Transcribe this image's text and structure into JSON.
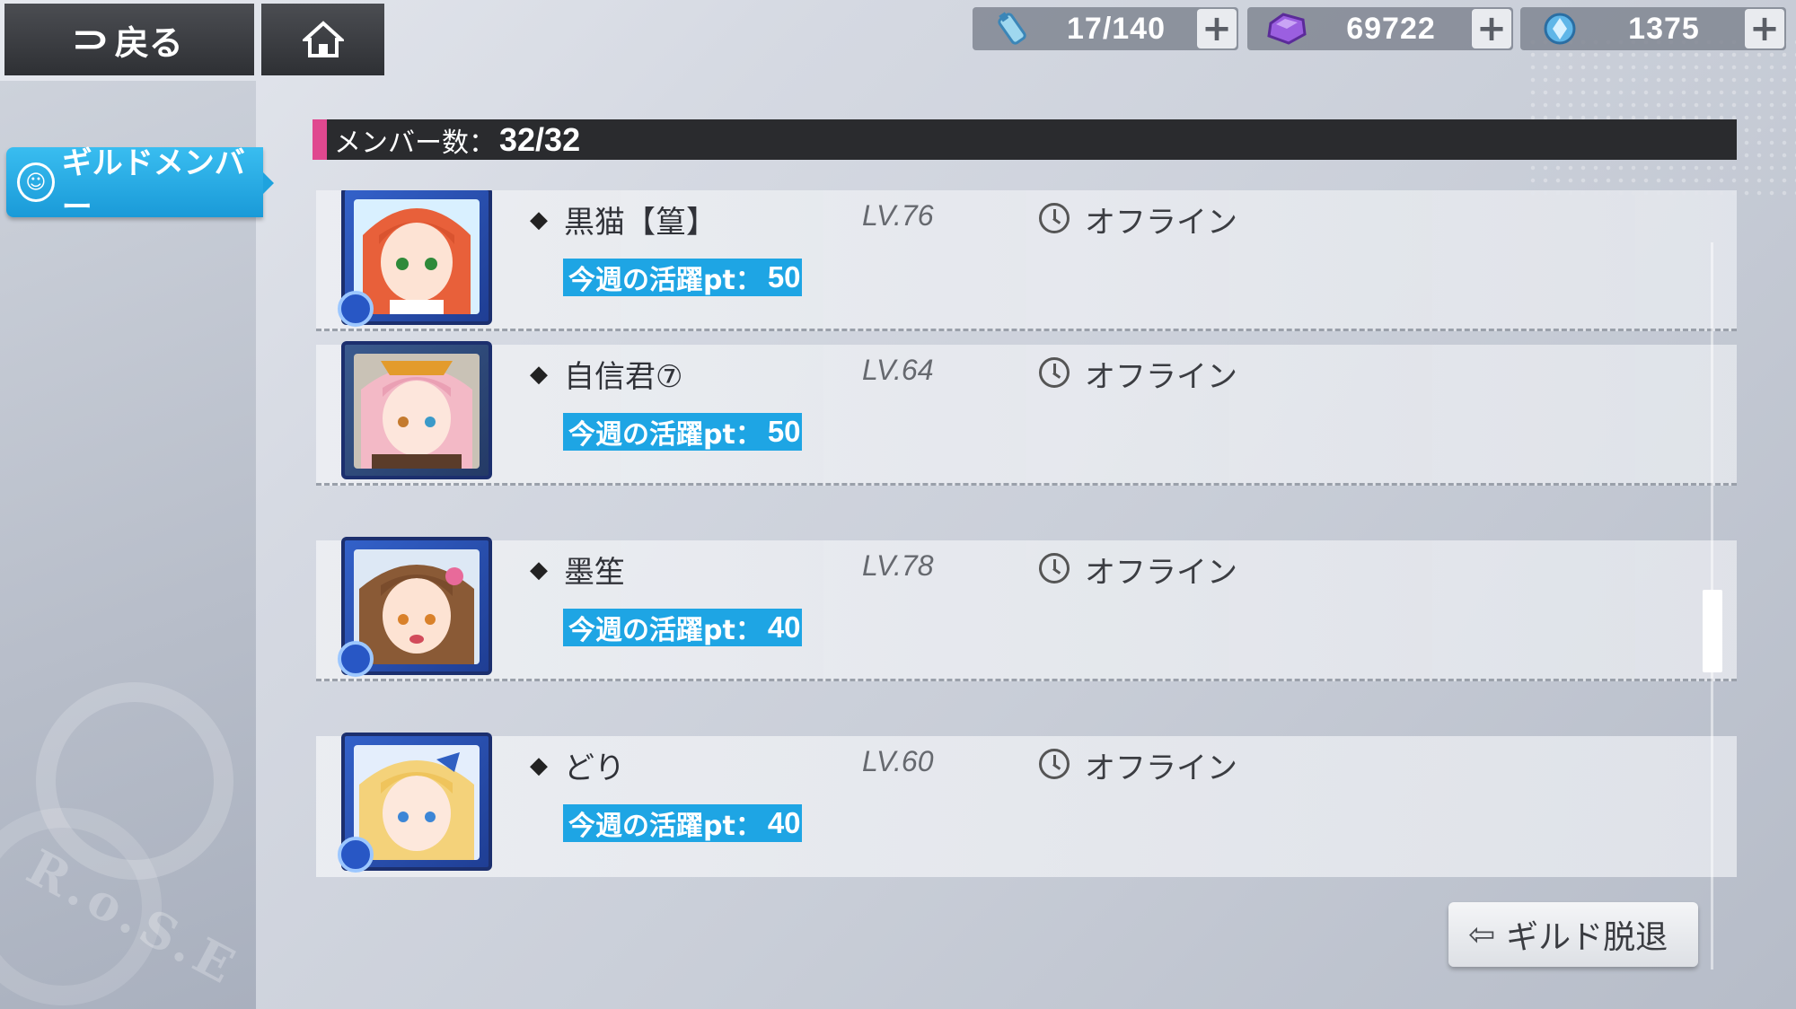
{
  "topbar": {
    "back_label": "戻る",
    "resources": [
      {
        "icon": "stamina-bottle-icon",
        "value": "17/140",
        "plus": "+"
      },
      {
        "icon": "purple-gem-icon",
        "value": "69722",
        "plus": "+"
      },
      {
        "icon": "blue-crystal-icon",
        "value": "1375",
        "plus": "+"
      }
    ]
  },
  "sidebar": {
    "tab_label": "ギルドメンバー"
  },
  "header": {
    "label": "メンバー数：",
    "count": "32/32"
  },
  "members": [
    {
      "name": "黒猫【篁】",
      "level": "LV.76",
      "status": "オフライン",
      "points_label": "今週の活躍pt：",
      "points": "50"
    },
    {
      "name": "自信君⑦",
      "level": "LV.64",
      "status": "オフライン",
      "points_label": "今週の活躍pt：",
      "points": "50"
    },
    {
      "name": "墨笙",
      "level": "LV.78",
      "status": "オフライン",
      "points_label": "今週の活躍pt：",
      "points": "40"
    },
    {
      "name": "どり",
      "level": "LV.60",
      "status": "オフライン",
      "points_label": "今週の活躍pt：",
      "points": "40"
    }
  ],
  "footer": {
    "leave_label": "ギルド脱退"
  },
  "background": {
    "watermark": "R.o.S.E"
  },
  "colors": {
    "accent_blue": "#1ea5e4",
    "header_pink": "#e0488f",
    "header_bg": "#2a2b2e"
  }
}
